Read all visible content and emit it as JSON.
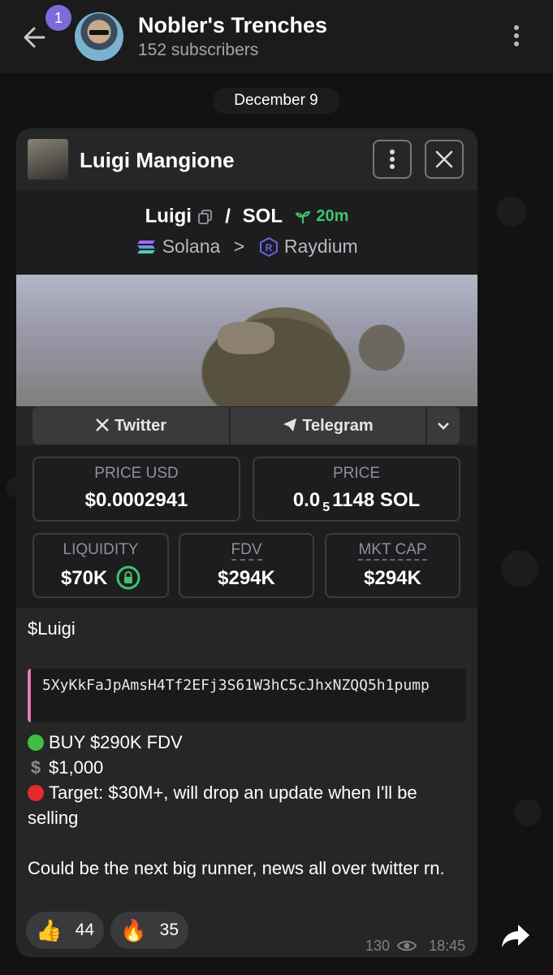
{
  "header": {
    "unread_badge": "1",
    "title": "Nobler's Trenches",
    "subtitle": "152 subscribers"
  },
  "date_separator": "December 9",
  "card": {
    "title": "Luigi Mangione",
    "pair": {
      "base": "Luigi",
      "sep": "/",
      "quote": "SOL",
      "age": "20m"
    },
    "chain": {
      "network": "Solana",
      "sep": ">",
      "dex": "Raydium"
    },
    "links": {
      "twitter": "Twitter",
      "telegram": "Telegram"
    },
    "stats": {
      "price_usd_label": "PRICE USD",
      "price_usd_value": "$0.0002941",
      "price_label": "PRICE",
      "price_value_a": "0.0",
      "price_value_sub": "5",
      "price_value_b": "1148 SOL",
      "liquidity_label": "LIQUIDITY",
      "liquidity_value": "$70K",
      "fdv_label": "FDV",
      "fdv_value": "$294K",
      "mktcap_label": "MKT CAP",
      "mktcap_value": "$294K"
    }
  },
  "message": {
    "ticker": "$Luigi",
    "contract": "5XyKkFaJpAmsH4Tf2EFj3S61W3hC5cJhxNZQQ5h1pump",
    "buy_line": "BUY $290K FDV",
    "amount_line": "$1,000",
    "target_line": "Target: $30M+, will drop an update when I'll be selling",
    "closing": "Could be the next big runner, news all over twitter rn."
  },
  "reactions": [
    {
      "emoji": "👍",
      "count": "44"
    },
    {
      "emoji": "🔥",
      "count": "35"
    }
  ],
  "meta": {
    "views": "130",
    "time": "18:45"
  },
  "colors": {
    "accent": "#7b6cd9",
    "green": "#3fc36b",
    "quote_bar": "#e07ab8"
  }
}
